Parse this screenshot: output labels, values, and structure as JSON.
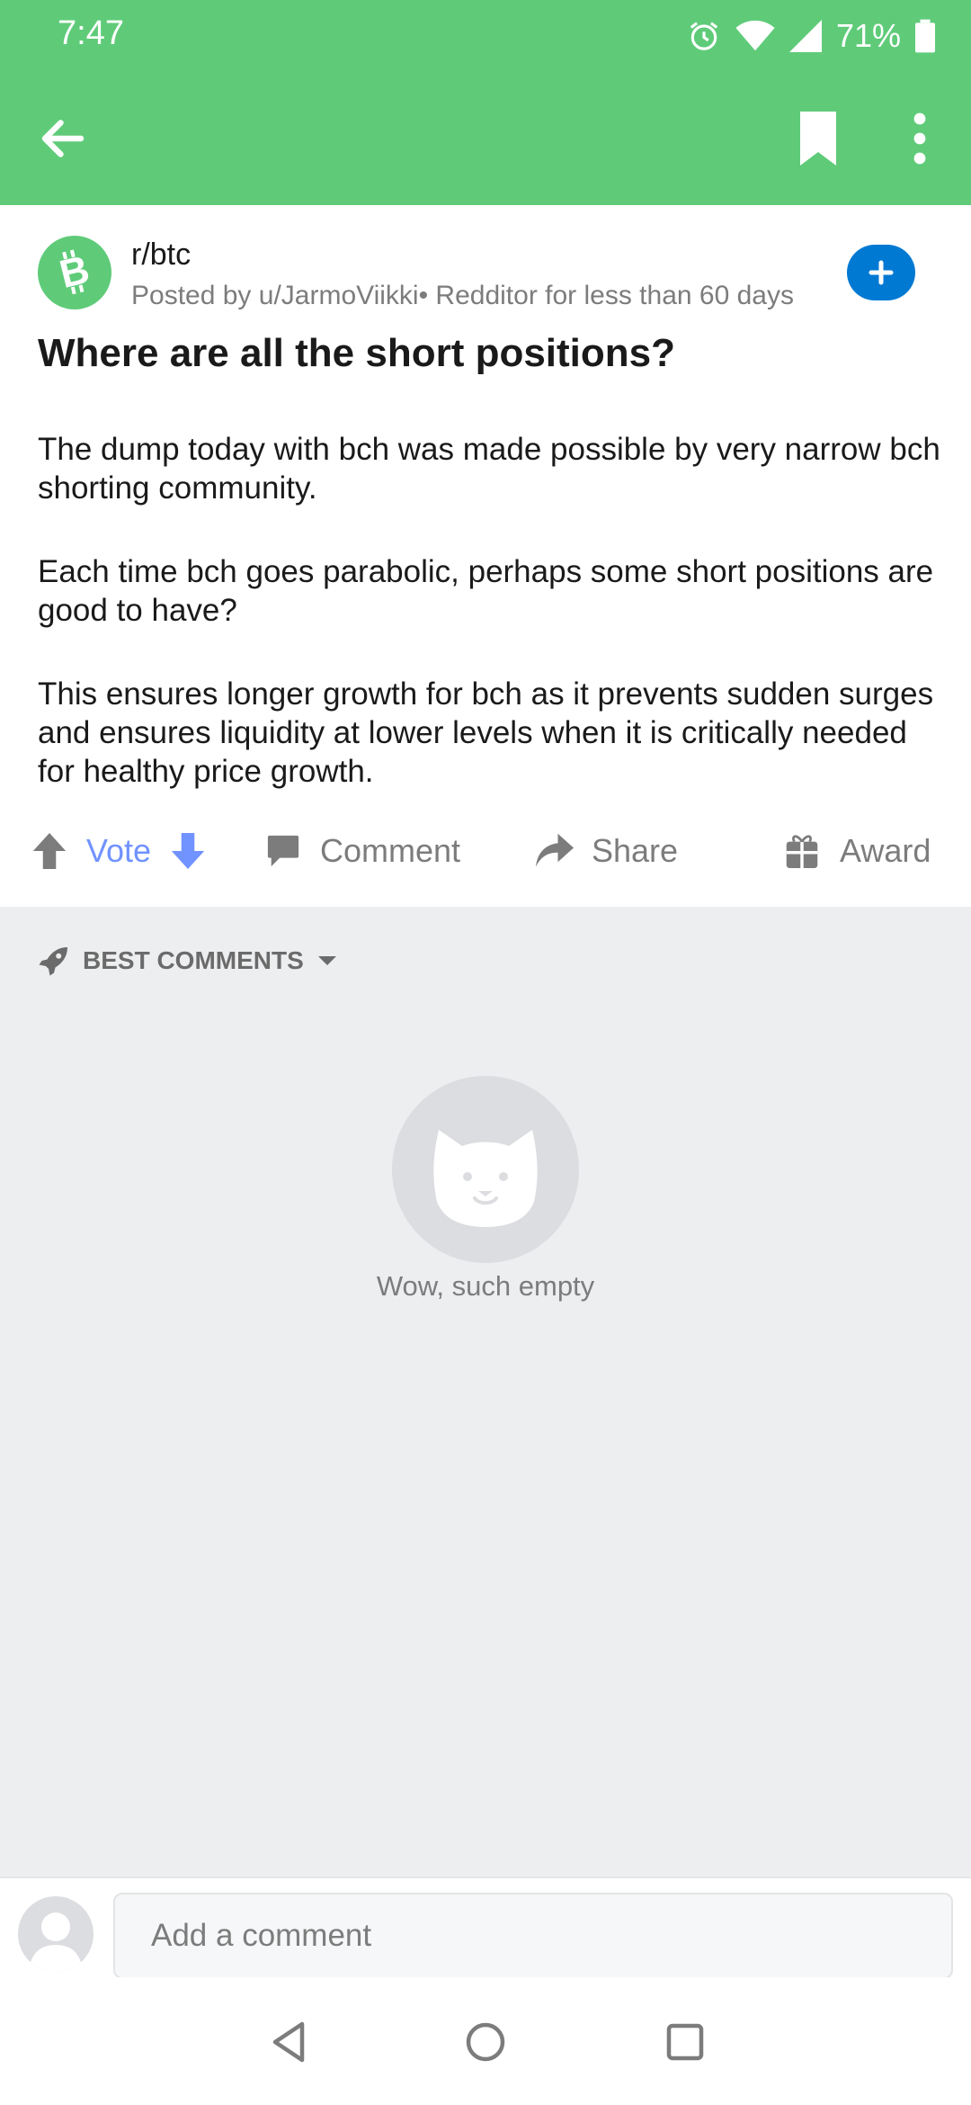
{
  "status_bar": {
    "time": "7:47",
    "battery": "71%",
    "icons": [
      "alarm-icon",
      "wifi-icon",
      "cell-signal-icon",
      "battery-icon"
    ]
  },
  "app_bar": {
    "icons": [
      "back-arrow-icon",
      "bookmark-icon",
      "more-vert-icon"
    ],
    "color": "#5fcb79"
  },
  "post": {
    "subreddit": "r/btc",
    "meta": "Posted by u/JarmoViikki• Redditor for less than 60 days",
    "title": "Where are all the short positions?",
    "body": [
      "The dump today with bch was made possible by very narrow bch shorting community.",
      "Each time bch goes parabolic, perhaps some short positions are good to have?",
      "This ensures longer growth for bch as it prevents sudden surges and ensures liquidity at lower levels when it is critically needed for healthy price growth."
    ],
    "subreddit_icon": "bitcoin-cash-icon"
  },
  "actions": {
    "vote": "Vote",
    "comment": "Comment",
    "share": "Share",
    "award": "Award",
    "vote_color": "#7193ff"
  },
  "comments": {
    "sort_label": "BEST COMMENTS",
    "empty_text": "Wow, such empty",
    "empty_icon": "cat-face-icon"
  },
  "composer": {
    "placeholder": "Add a comment"
  },
  "nav_bar": {
    "icons": [
      "nav-back-icon",
      "nav-home-icon",
      "nav-recents-icon"
    ]
  }
}
